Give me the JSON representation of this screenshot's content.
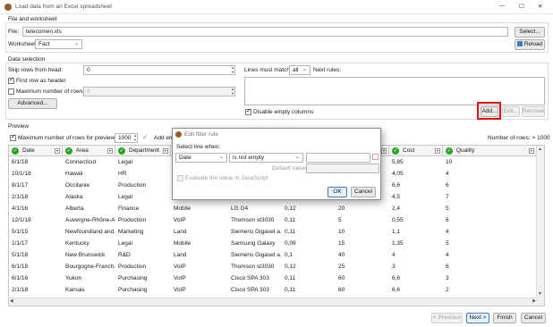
{
  "window": {
    "title": "Load data from an Excel spreadsheet",
    "controls": {
      "minimize": "—",
      "maximize": "☐",
      "close": "✕"
    }
  },
  "file_section": {
    "title": "File and worksheet",
    "file_label": "File:",
    "file_value": "telecomen.xls",
    "select_button": "Select...",
    "worksheet_label": "Worksheet",
    "worksheet_value": "Fact",
    "reload_button": "Reload"
  },
  "data_selection": {
    "title": "Data selection",
    "skip_rows_label": "Skip rows from head:",
    "skip_rows_value": "0",
    "first_row_header_label": "First row as header",
    "max_rows_label": "Maximum number of rows:",
    "max_rows_value": "0",
    "advanced_button": "Advanced...",
    "lines_must_match_label": "Lines must match",
    "lines_must_match_value": "all",
    "next_rules_label": "Next rules:",
    "disable_empty_columns_label": "Disable empty columns",
    "add_button": "Add...",
    "edit_button": "Edit...",
    "remove_button": "Remove"
  },
  "preview": {
    "title": "Preview",
    "max_rows_preview_label": "Maximum number of rows for preview:",
    "max_rows_preview_value": "1000",
    "add_label": "Add em",
    "num_rows_label": "Number of rows: > 1000",
    "columns": [
      "Date",
      "Area",
      "Department",
      "",
      "",
      "",
      "",
      "Cost",
      "Quality"
    ],
    "rows": [
      [
        "6/1/18",
        "Connecticut",
        "Legal",
        "",
        "",
        "",
        "",
        "5,85",
        "10"
      ],
      [
        "10/1/18",
        "Hawaii",
        "HR",
        "",
        "",
        "",
        "",
        "4,05",
        "4"
      ],
      [
        "8/1/17",
        "Occitanie",
        "Production",
        "",
        "",
        "",
        "",
        "6,6",
        "6"
      ],
      [
        "2/1/18",
        "Alaska",
        "Legal",
        "",
        "",
        "",
        "",
        "4,5",
        "7"
      ],
      [
        "4/1/16",
        "Alberta",
        "Finance",
        "Mobile",
        "LG G4",
        "0,12",
        "20",
        "2,4",
        "5"
      ],
      [
        "12/1/18",
        "Auvergne-Rhône-A...",
        "Production",
        "VoIP",
        "Thomson st3030",
        "0,11",
        "5",
        "0,55",
        "6"
      ],
      [
        "5/1/15",
        "Newfoundland and...",
        "Marketing",
        "Land",
        "Siemens Gigaset a...",
        "0,11",
        "10",
        "1,1",
        "4"
      ],
      [
        "1/1/17",
        "Kentucky",
        "Legal",
        "Mobile",
        "Samsung Galaxy",
        "0,09",
        "15",
        "1,35",
        "5"
      ],
      [
        "5/1/18",
        "New Brunswick",
        "R&D",
        "Land",
        "Siemens Gigaset a...",
        "0,1",
        "40",
        "4",
        "4"
      ],
      [
        "6/1/18",
        "Bourgogne-Franch...",
        "Production",
        "VoIP",
        "Thomson st3030",
        "0,12",
        "25",
        "3",
        "6"
      ],
      [
        "6/1/16",
        "Yukon",
        "Purchasing",
        "VoIP",
        "Cisco SPA 303",
        "0,11",
        "60",
        "6,6",
        "3"
      ],
      [
        "2/1/18",
        "Kansas",
        "Purchasing",
        "VoIP",
        "Cisco SPA 303",
        "0,11",
        "60",
        "6,6",
        "2"
      ]
    ]
  },
  "dialog": {
    "title": "Edit filter rule",
    "select_line_label": "Select line when:",
    "field_value": "Date",
    "operator_value": "is not empty",
    "value_input": "",
    "default_value_label": "Default value:",
    "evaluate_js_label": "Evaluate the value in JavaScript",
    "ok_button": "OK",
    "cancel_button": "Cancel"
  },
  "footer": {
    "previous_button": "< Previous",
    "next_button": "Next >",
    "finish_button": "Finish",
    "cancel_button": "Cancel"
  },
  "colors": {
    "highlight": "#e01010",
    "ok_icon": "#2aa52a",
    "accent": "#3c7fc6"
  },
  "icons": [
    "app-icon",
    "reload-icon",
    "ok-status-icon",
    "dropdown-arrow-icon"
  ]
}
